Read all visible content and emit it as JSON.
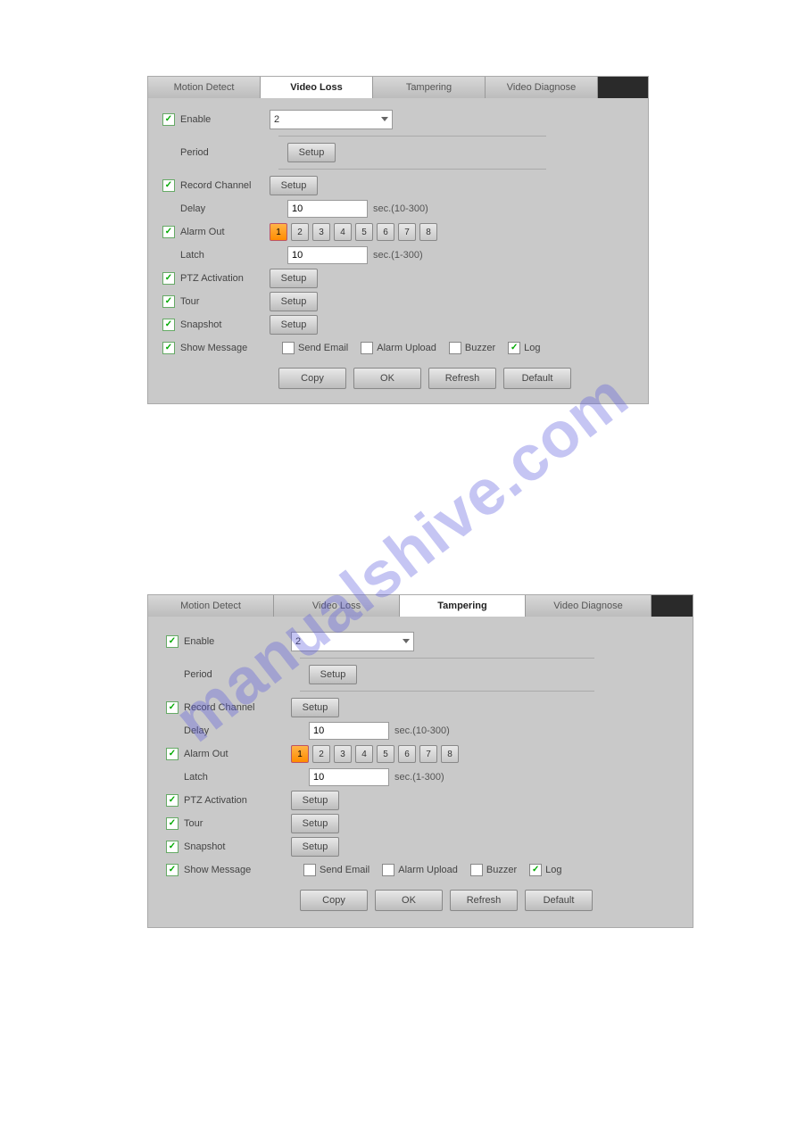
{
  "watermark": "manualshive.com",
  "panels": [
    {
      "activeTabIndex": 1,
      "tabs": [
        "Motion Detect",
        "Video Loss",
        "Tampering",
        "Video Diagnose"
      ],
      "enable": {
        "checked": true,
        "label": "Enable",
        "channel": "2"
      },
      "period": {
        "label": "Period",
        "button": "Setup"
      },
      "recordChannel": {
        "checked": true,
        "label": "Record Channel",
        "button": "Setup"
      },
      "delay": {
        "label": "Delay",
        "value": "10",
        "hint": "sec.(10-300)"
      },
      "alarmOut": {
        "checked": true,
        "label": "Alarm Out",
        "buttons": [
          "1",
          "2",
          "3",
          "4",
          "5",
          "6",
          "7",
          "8"
        ],
        "active": 0
      },
      "latch": {
        "label": "Latch",
        "value": "10",
        "hint": "sec.(1-300)"
      },
      "ptz": {
        "checked": true,
        "label": "PTZ Activation",
        "button": "Setup"
      },
      "tour": {
        "checked": true,
        "label": "Tour",
        "button": "Setup"
      },
      "snapshot": {
        "checked": true,
        "label": "Snapshot",
        "button": "Setup"
      },
      "showMessage": {
        "checked": true,
        "label": "Show Message",
        "opts": [
          {
            "label": "Send Email",
            "checked": false
          },
          {
            "label": "Alarm Upload",
            "checked": false
          },
          {
            "label": "Buzzer",
            "checked": false
          },
          {
            "label": "Log",
            "checked": true
          }
        ]
      },
      "bottom": [
        "Copy",
        "OK",
        "Refresh",
        "Default"
      ]
    },
    {
      "activeTabIndex": 2,
      "tabs": [
        "Motion Detect",
        "Video Loss",
        "Tampering",
        "Video Diagnose"
      ],
      "enable": {
        "checked": true,
        "label": "Enable",
        "channel": "2"
      },
      "period": {
        "label": "Period",
        "button": "Setup"
      },
      "recordChannel": {
        "checked": true,
        "label": "Record Channel",
        "button": "Setup"
      },
      "delay": {
        "label": "Delay",
        "value": "10",
        "hint": "sec.(10-300)"
      },
      "alarmOut": {
        "checked": true,
        "label": "Alarm Out",
        "buttons": [
          "1",
          "2",
          "3",
          "4",
          "5",
          "6",
          "7",
          "8"
        ],
        "active": 0
      },
      "latch": {
        "label": "Latch",
        "value": "10",
        "hint": "sec.(1-300)"
      },
      "ptz": {
        "checked": true,
        "label": "PTZ Activation",
        "button": "Setup"
      },
      "tour": {
        "checked": true,
        "label": "Tour",
        "button": "Setup"
      },
      "snapshot": {
        "checked": true,
        "label": "Snapshot",
        "button": "Setup"
      },
      "showMessage": {
        "checked": true,
        "label": "Show Message",
        "opts": [
          {
            "label": "Send Email",
            "checked": false
          },
          {
            "label": "Alarm Upload",
            "checked": false
          },
          {
            "label": "Buzzer",
            "checked": false
          },
          {
            "label": "Log",
            "checked": true
          }
        ]
      },
      "bottom": [
        "Copy",
        "OK",
        "Refresh",
        "Default"
      ]
    }
  ]
}
